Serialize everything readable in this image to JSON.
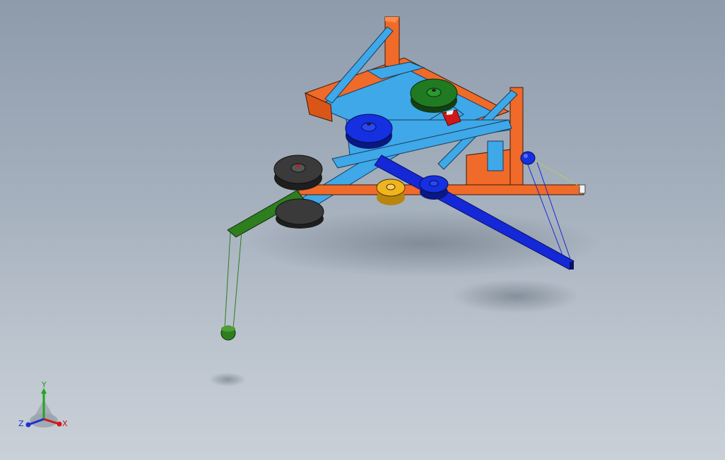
{
  "window": {
    "title": "",
    "background_top": "#8e9bab",
    "background_bottom": "#c9d0d8"
  },
  "model": {
    "description_visible": false,
    "colors": {
      "frame_orange": "#f06a2a",
      "frame_light_blue": "#3ea8e8",
      "arm_blue": "#1428d8",
      "arm_green": "#2e7d1e",
      "pulley_green": "#1f7a22",
      "pulley_blue": "#1530e0",
      "pulley_gray": "#3a3a3a",
      "pulley_yellow": "#f0b41e",
      "bracket_red": "#d01818"
    }
  },
  "triad": {
    "y_label": "Y",
    "x_label": "X",
    "z_label": "Z",
    "x_color": "#d01818",
    "y_color": "#1ea81e",
    "z_color": "#1c2fd0"
  }
}
